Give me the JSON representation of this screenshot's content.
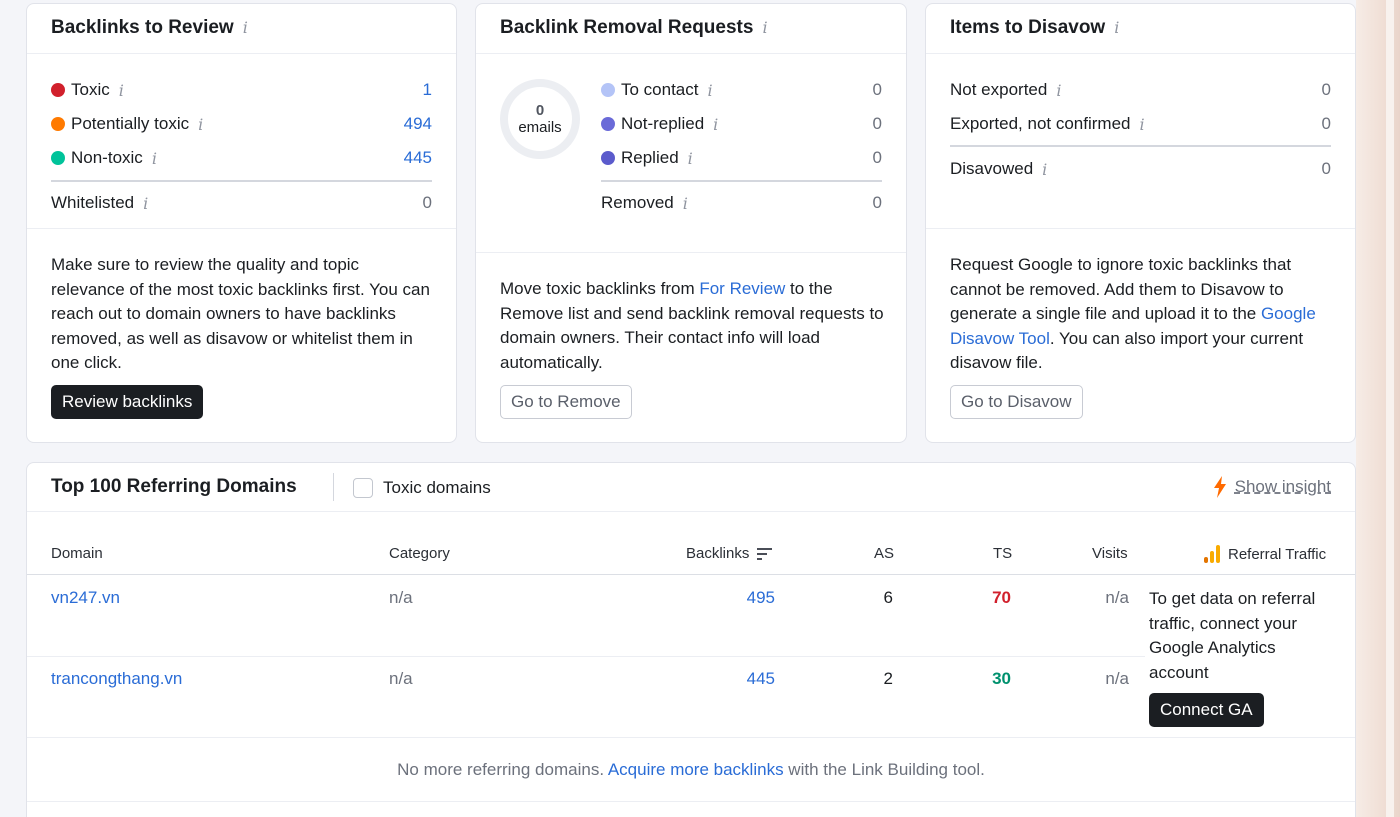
{
  "review_card": {
    "title": "Backlinks to Review",
    "rows": [
      {
        "label": "Toxic",
        "value": "1",
        "color": "#d1202c"
      },
      {
        "label": "Potentially toxic",
        "value": "494",
        "color": "#ff7a00"
      },
      {
        "label": "Non-toxic",
        "value": "445",
        "color": "#00c39a"
      }
    ],
    "whitelisted_label": "Whitelisted",
    "whitelisted_value": "0",
    "description": "Make sure to review the quality and topic relevance of the most toxic backlinks first. You can reach out to domain owners to have backlinks removed, as well as disavow or whitelist them in one click.",
    "button": "Review backlinks"
  },
  "removal_card": {
    "title": "Backlink Removal Requests",
    "donut_count": "0",
    "donut_unit": "emails",
    "rows": [
      {
        "label": "To contact",
        "value": "0",
        "color": "#b4c4f7"
      },
      {
        "label": "Not-replied",
        "value": "0",
        "color": "#6a6ad8"
      },
      {
        "label": "Replied",
        "value": "0",
        "color": "#5b5bcc"
      }
    ],
    "removed_label": "Removed",
    "removed_value": "0",
    "desc_part1": "Move toxic backlinks from ",
    "desc_link": "For Review",
    "desc_part2": " to the Remove list and send backlink removal requests to domain owners. Their contact info will load automatically.",
    "button": "Go to Remove"
  },
  "disavow_card": {
    "title": "Items to Disavow",
    "rows": [
      {
        "label": "Not exported",
        "value": "0"
      },
      {
        "label": "Exported, not confirmed",
        "value": "0"
      }
    ],
    "disavowed_label": "Disavowed",
    "disavowed_value": "0",
    "desc_part1": "Request Google to ignore toxic backlinks that cannot be removed. Add them to Disavow to generate a single file and upload it to the ",
    "desc_link": "Google Disavow Tool",
    "desc_part2": ". You can also import your current disavow file.",
    "button": "Go to Disavow"
  },
  "domains": {
    "title": "Top 100 Referring Domains",
    "toxic_checkbox_label": "Toxic domains",
    "toxic_checked": false,
    "insight_label": "Show insight",
    "columns": {
      "domain": "Domain",
      "category": "Category",
      "backlinks": "Backlinks",
      "as": "AS",
      "ts": "TS",
      "visits": "Visits",
      "referral": "Referral Traffic"
    },
    "rows": [
      {
        "domain": "vn247.vn",
        "category": "n/a",
        "backlinks": "495",
        "as": "6",
        "ts": "70",
        "ts_color": "#d1202c",
        "visits": "n/a"
      },
      {
        "domain": "trancongthang.vn",
        "category": "n/a",
        "backlinks": "445",
        "as": "2",
        "ts": "30",
        "ts_color": "#00916e",
        "visits": "n/a"
      }
    ],
    "ga_message": "To get data on referral traffic, connect your Google Analytics account",
    "ga_button": "Connect GA",
    "footer_part1": "No more referring domains. ",
    "footer_link": "Acquire more backlinks",
    "footer_part2": " with the Link Building tool."
  }
}
